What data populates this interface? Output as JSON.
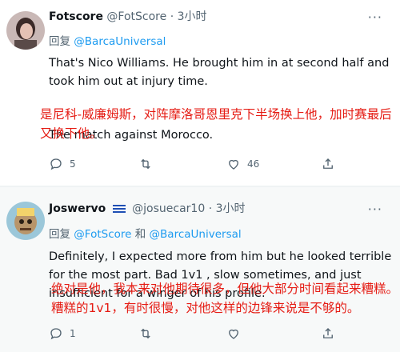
{
  "tweets": [
    {
      "author_name": "Fotscore",
      "handle": "@FotScore",
      "separator": "·",
      "time": "3小时",
      "reply_prefix": "回复",
      "reply_mentions": "@BarcaUniversal",
      "reply_conj": "",
      "reply_mention2": "",
      "body_line1": "That's Nico Williams. He brought him in at second half and took him out at injury time.",
      "body_line2": "The match against Morocco.",
      "overlay_lines": [
        "是尼科-威廉姆斯，对阵摩洛哥恩里克下半场换上他，加时赛最后",
        "又换下他。"
      ],
      "replies": "5",
      "retweets": "",
      "likes": "46"
    },
    {
      "author_name": "Joswervo",
      "handle": "@josuecar10",
      "separator": "·",
      "time": "3小时",
      "reply_prefix": "回复",
      "reply_mentions": "@FotScore",
      "reply_conj": "和",
      "reply_mention2": "@BarcaUniversal",
      "body_text": "Definitely, I expected more from him but he looked terrible for the most part. Bad 1v1 , slow sometimes, and just insufficient for a winger of his profile.",
      "overlay_lines": [
        "绝对是他，我本来对他期待很多，但他大部分时间看起来糟糕。",
        "糟糕的1v1，有时很慢，对他这样的边锋来说是不够的。"
      ],
      "replies": "1",
      "retweets": "",
      "likes": ""
    }
  ],
  "colors": {
    "accent": "#1d9bf0",
    "overlay_red": "#e51c14",
    "muted": "#536471"
  }
}
